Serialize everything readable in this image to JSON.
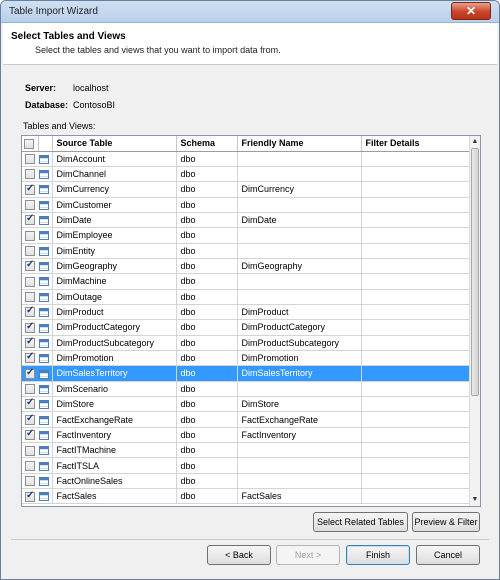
{
  "window": {
    "title": "Table Import Wizard",
    "close_glyph": "✕"
  },
  "header": {
    "title": "Select Tables and Views",
    "subtitle": "Select the tables and views that you want to import data from."
  },
  "connection": {
    "server_label": "Server:",
    "server_value": "localhost",
    "database_label": "Database:",
    "database_value": "ContosoBI"
  },
  "list_label": "Tables and Views:",
  "grid": {
    "columns": [
      "Source Table",
      "Schema",
      "Friendly Name",
      "Filter Details"
    ],
    "rows": [
      {
        "checked": false,
        "source": "DimAccount",
        "schema": "dbo",
        "friendly": "",
        "filter": ""
      },
      {
        "checked": false,
        "source": "DimChannel",
        "schema": "dbo",
        "friendly": "",
        "filter": ""
      },
      {
        "checked": true,
        "source": "DimCurrency",
        "schema": "dbo",
        "friendly": "DimCurrency",
        "filter": ""
      },
      {
        "checked": false,
        "source": "DimCustomer",
        "schema": "dbo",
        "friendly": "",
        "filter": ""
      },
      {
        "checked": true,
        "source": "DimDate",
        "schema": "dbo",
        "friendly": "DimDate",
        "filter": ""
      },
      {
        "checked": false,
        "source": "DimEmployee",
        "schema": "dbo",
        "friendly": "",
        "filter": ""
      },
      {
        "checked": false,
        "source": "DimEntity",
        "schema": "dbo",
        "friendly": "",
        "filter": ""
      },
      {
        "checked": true,
        "source": "DimGeography",
        "schema": "dbo",
        "friendly": "DimGeography",
        "filter": ""
      },
      {
        "checked": false,
        "source": "DimMachine",
        "schema": "dbo",
        "friendly": "",
        "filter": ""
      },
      {
        "checked": false,
        "source": "DimOutage",
        "schema": "dbo",
        "friendly": "",
        "filter": ""
      },
      {
        "checked": true,
        "source": "DimProduct",
        "schema": "dbo",
        "friendly": "DimProduct",
        "filter": ""
      },
      {
        "checked": true,
        "source": "DimProductCategory",
        "schema": "dbo",
        "friendly": "DimProductCategory",
        "filter": ""
      },
      {
        "checked": true,
        "source": "DimProductSubcategory",
        "schema": "dbo",
        "friendly": "DimProductSubcategory",
        "filter": ""
      },
      {
        "checked": true,
        "source": "DimPromotion",
        "schema": "dbo",
        "friendly": "DimPromotion",
        "filter": ""
      },
      {
        "checked": true,
        "source": "DimSalesTerritory",
        "schema": "dbo",
        "friendly": "DimSalesTerritory",
        "filter": "",
        "selected": true
      },
      {
        "checked": false,
        "source": "DimScenario",
        "schema": "dbo",
        "friendly": "",
        "filter": ""
      },
      {
        "checked": true,
        "source": "DimStore",
        "schema": "dbo",
        "friendly": "DimStore",
        "filter": ""
      },
      {
        "checked": true,
        "source": "FactExchangeRate",
        "schema": "dbo",
        "friendly": "FactExchangeRate",
        "filter": ""
      },
      {
        "checked": true,
        "source": "FactInventory",
        "schema": "dbo",
        "friendly": "FactInventory",
        "filter": ""
      },
      {
        "checked": false,
        "source": "FactITMachine",
        "schema": "dbo",
        "friendly": "",
        "filter": ""
      },
      {
        "checked": false,
        "source": "FactITSLA",
        "schema": "dbo",
        "friendly": "",
        "filter": ""
      },
      {
        "checked": false,
        "source": "FactOnlineSales",
        "schema": "dbo",
        "friendly": "",
        "filter": ""
      },
      {
        "checked": true,
        "source": "FactSales",
        "schema": "dbo",
        "friendly": "FactSales",
        "filter": ""
      }
    ]
  },
  "buttons": {
    "select_related": "Select Related Tables",
    "preview_filter": "Preview & Filter",
    "back": "< Back",
    "next": "Next >",
    "finish": "Finish",
    "cancel": "Cancel"
  },
  "colors": {
    "selection": "#3399ff",
    "accent": "#3c7fb1"
  }
}
